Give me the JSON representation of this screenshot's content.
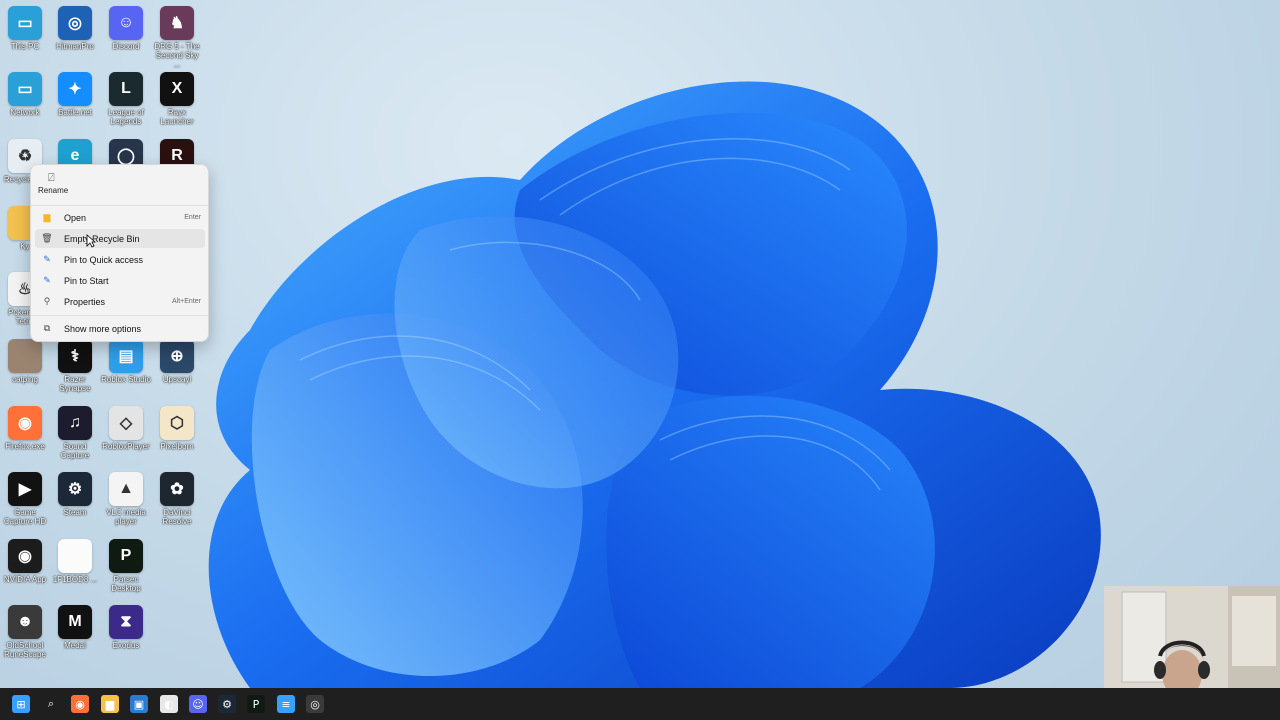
{
  "desktop_icons": [
    {
      "label": "This PC",
      "glyph": "monitor-icon",
      "bg": "#2a9fd8",
      "text": "▭"
    },
    {
      "label": "HitmanPro",
      "glyph": "hitmanpro-icon",
      "bg": "#1e62b5",
      "text": "◎"
    },
    {
      "label": "Discord",
      "glyph": "discord-icon",
      "bg": "#5865f2",
      "text": "☺"
    },
    {
      "label": "DRG 5 - The Second Sky ...",
      "glyph": "game-icon",
      "bg": "#6a3a5a",
      "text": "♞"
    },
    {
      "label": "Network",
      "glyph": "network-icon",
      "bg": "#2a9fd8",
      "text": "▭"
    },
    {
      "label": "Battle.net",
      "glyph": "battlenet-icon",
      "bg": "#148eff",
      "text": "✦"
    },
    {
      "label": "League of Legends",
      "glyph": "league-icon",
      "bg": "#1a2a2e",
      "text": "L"
    },
    {
      "label": "Rayx Launcher",
      "glyph": "launcher-icon",
      "bg": "#111111",
      "text": "X"
    },
    {
      "label": "Recycle Bin",
      "glyph": "recycle-bin-icon",
      "bg": "#e7eef3",
      "text": "♻"
    },
    {
      "label": "",
      "glyph": "edge-icon",
      "bg": "#1ea0d0",
      "text": "e"
    },
    {
      "label": "",
      "glyph": "app-icon",
      "bg": "#27354a",
      "text": "◯"
    },
    {
      "label": "",
      "glyph": "app-icon",
      "bg": "#2b1010",
      "text": "R"
    },
    {
      "label": "Ky",
      "glyph": "folder-icon",
      "bg": "#f2c14e",
      "text": ""
    },
    {
      "label": "Pokemon Tetris",
      "glyph": "java-icon",
      "bg": "#f3f3f3",
      "text": "♨"
    },
    {
      "label": "catping",
      "glyph": "image-icon",
      "bg": "#9a8470",
      "text": ""
    },
    {
      "label": "Razer Synapse",
      "glyph": "razer-icon",
      "bg": "#111111",
      "text": "⚕"
    },
    {
      "label": "Roblox Studio",
      "glyph": "roblox-studio-icon",
      "bg": "#2f9ee9",
      "text": "▤"
    },
    {
      "label": "Upscayl",
      "glyph": "upscayl-icon",
      "bg": "#2a4868",
      "text": "⊕"
    },
    {
      "label": "Firefox.exe",
      "glyph": "firefox-icon",
      "bg": "#ff7139",
      "text": "◉"
    },
    {
      "label": "Sound Capture",
      "glyph": "sound-capture-icon",
      "bg": "#1c1c2e",
      "text": "♫"
    },
    {
      "label": "RobloxPlayer",
      "glyph": "roblox-player-icon",
      "bg": "#e4e4e4",
      "text": "◇"
    },
    {
      "label": "Pixelborn",
      "glyph": "pixelborn-icon",
      "bg": "#f4e7c8",
      "text": "⬡"
    },
    {
      "label": "Game Capture HD",
      "glyph": "game-capture-icon",
      "bg": "#121212",
      "text": "▶"
    },
    {
      "label": "Steam",
      "glyph": "steam-icon",
      "bg": "#1b2838",
      "text": "⚙"
    },
    {
      "label": "VLC media player",
      "glyph": "vlc-icon",
      "bg": "#f4f4f4",
      "text": "▲"
    },
    {
      "label": "DaVinci Resolve",
      "glyph": "davinci-icon",
      "bg": "#1e2730",
      "text": "✿"
    },
    {
      "label": "NVIDIA App",
      "glyph": "nvidia-icon",
      "bg": "#1c1c1c",
      "text": "◉"
    },
    {
      "label": "1F1BOD8 ...",
      "glyph": "file-icon",
      "bg": "#fbfbfb",
      "text": ""
    },
    {
      "label": "Parsec Desktop",
      "glyph": "parsec-icon",
      "bg": "#0f1a12",
      "text": "P"
    },
    {
      "label": "OldSchool RuneScape",
      "glyph": "runescape-icon",
      "bg": "#3a3a3a",
      "text": "☻"
    },
    {
      "label": "Medal",
      "glyph": "medal-icon",
      "bg": "#111111",
      "text": "M"
    },
    {
      "label": "Exodus",
      "glyph": "exodus-icon",
      "bg": "#3b2a8a",
      "text": "⧗"
    }
  ],
  "context_menu": {
    "rename_label": "Rename",
    "items": [
      {
        "label": "Open",
        "icon": "folder-icon",
        "icon_text": "▆",
        "shortcut": "Enter"
      },
      {
        "label": "Empty Recycle Bin",
        "icon": "trash-icon",
        "icon_text": "🗑",
        "shortcut": ""
      },
      {
        "label": "Pin to Quick access",
        "icon": "pin-icon",
        "icon_text": "✎",
        "shortcut": ""
      },
      {
        "label": "Pin to Start",
        "icon": "pin-icon",
        "icon_text": "✎",
        "shortcut": ""
      },
      {
        "label": "Properties",
        "icon": "wrench-icon",
        "icon_text": "⚲",
        "shortcut": "Alt+Enter"
      },
      {
        "label": "Show more options",
        "icon": "share-icon",
        "icon_text": "⧉",
        "shortcut": ""
      }
    ]
  },
  "taskbar_icons": [
    {
      "name": "start-icon",
      "text": "⊞",
      "bg": "#3aa0ff"
    },
    {
      "name": "search-icon",
      "text": "⌕",
      "bg": "transparent"
    },
    {
      "name": "firefox-icon",
      "text": "◉",
      "bg": "#ff7139"
    },
    {
      "name": "file-explorer-icon",
      "text": "▆",
      "bg": "#f2c14e"
    },
    {
      "name": "photos-icon",
      "text": "▣",
      "bg": "#2b7bd3"
    },
    {
      "name": "app-icon",
      "text": "◐",
      "bg": "#e8e8e8"
    },
    {
      "name": "discord-icon",
      "text": "☺",
      "bg": "#5865f2"
    },
    {
      "name": "steam-icon",
      "text": "⚙",
      "bg": "#1b2838"
    },
    {
      "name": "parsec-icon",
      "text": "P",
      "bg": "#0f1a12"
    },
    {
      "name": "notepad-icon",
      "text": "≡",
      "bg": "#3aa0ff"
    },
    {
      "name": "chrome-icon",
      "text": "◎",
      "bg": "#3a3a3a"
    }
  ],
  "colors": {
    "taskbar": "#1f1f1f",
    "menu_bg": "#f3f3f3",
    "wallpaper_blue": "#1e6ff0"
  }
}
